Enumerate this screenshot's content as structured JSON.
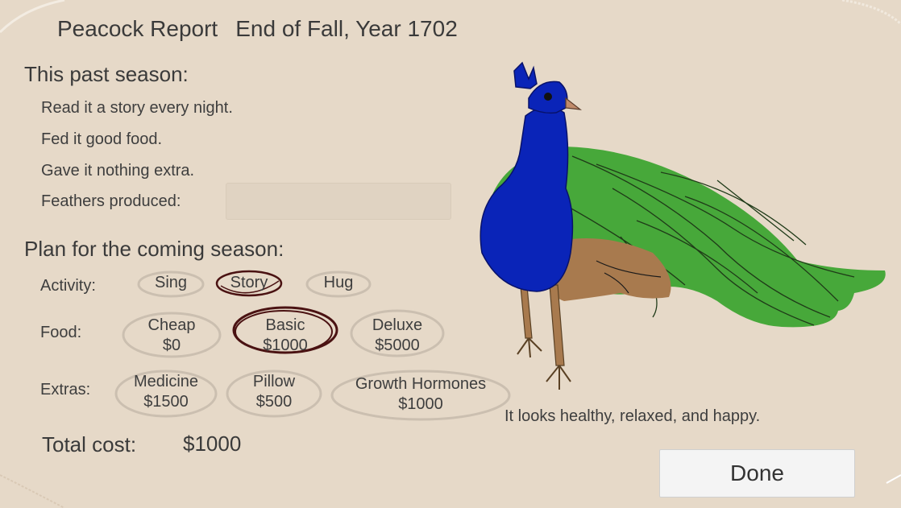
{
  "report": {
    "title": "Peacock Report",
    "period": "End of Fall, Year 1702"
  },
  "past_season": {
    "heading": "This past season:",
    "lines": [
      "Read it a story every night.",
      "Fed it good food.",
      "Gave it nothing extra."
    ],
    "feathers_label": "Feathers produced:",
    "feathers_value": ""
  },
  "plan": {
    "heading": "Plan for the coming season:",
    "activity": {
      "label": "Activity:",
      "options": [
        {
          "name": "Sing",
          "selected": false
        },
        {
          "name": "Story",
          "selected": true
        },
        {
          "name": "Hug",
          "selected": false
        }
      ]
    },
    "food": {
      "label": "Food:",
      "options": [
        {
          "name": "Cheap",
          "price": "$0",
          "selected": false
        },
        {
          "name": "Basic",
          "price": "$1000",
          "selected": true
        },
        {
          "name": "Deluxe",
          "price": "$5000",
          "selected": false
        }
      ]
    },
    "extras": {
      "label": "Extras:",
      "options": [
        {
          "name": "Medicine",
          "price": "$1500",
          "selected": false
        },
        {
          "name": "Pillow",
          "price": "$500",
          "selected": false
        },
        {
          "name": "Growth Hormones",
          "price": "$1000",
          "selected": false
        }
      ]
    }
  },
  "total": {
    "label": "Total cost:",
    "value": "$1000"
  },
  "status_text": "It looks healthy, relaxed, and happy.",
  "done_label": "Done",
  "colors": {
    "background": "#e6d9c8",
    "selected_ring": "#4a1212",
    "unselected_ring": "#cbbfb0",
    "peacock_body": "#0a24b8",
    "peacock_tail": "#47a83a",
    "peacock_wing": "#a87a4e"
  }
}
